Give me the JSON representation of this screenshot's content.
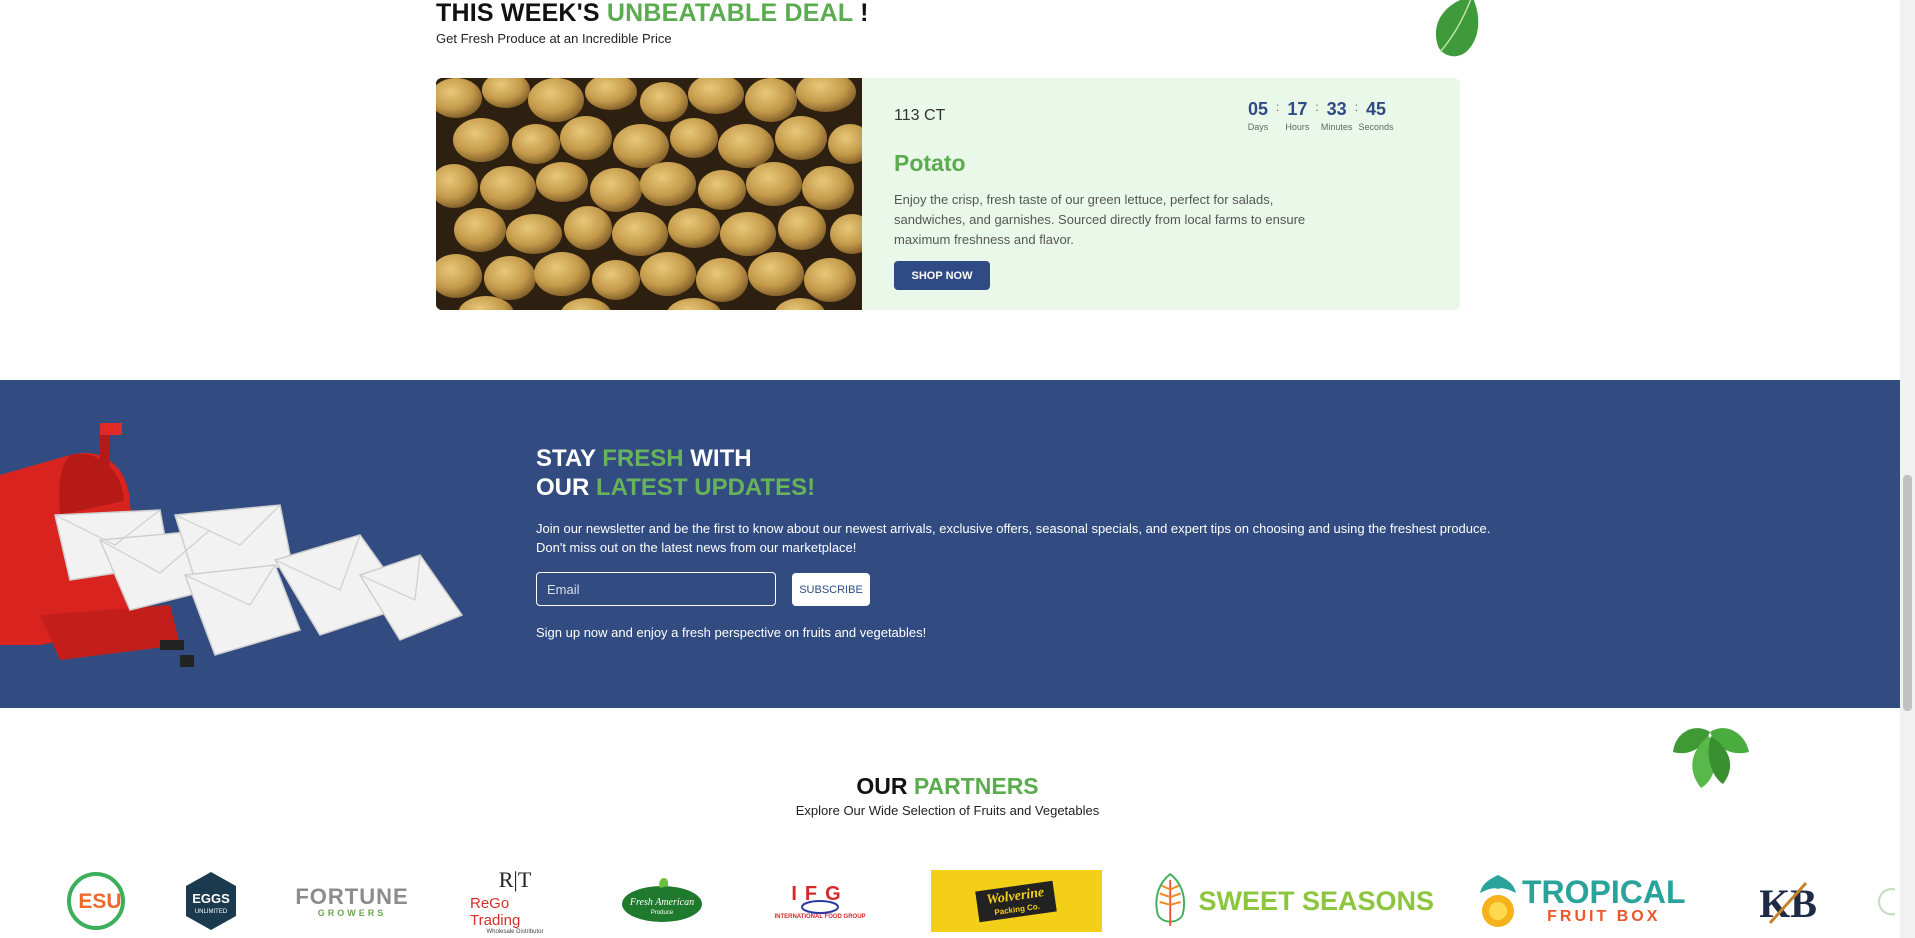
{
  "deal": {
    "title_prefix": "THIS WEEK'S",
    "title_highlight": "UNBEATABLE DEAL",
    "title_suffix": "!",
    "subtitle": "Get Fresh Produce at an Incredible Price",
    "count": "113 CT",
    "product": "Potato",
    "description": "Enjoy the crisp, fresh taste of our green lettuce, perfect for salads, sandwiches, and garnishes. Sourced directly from local farms to ensure maximum freshness and flavor.",
    "cta": "SHOP NOW",
    "countdown": [
      {
        "value": "05",
        "label": "Days"
      },
      {
        "value": "17",
        "label": "Hours"
      },
      {
        "value": "33",
        "label": "Minutes"
      },
      {
        "value": "45",
        "label": "Seconds"
      }
    ],
    "separator": ":"
  },
  "newsletter": {
    "line1_a": "STAY",
    "line1_b": "FRESH",
    "line1_c": "WITH",
    "line2_a": "OUR",
    "line2_b": "LATEST UPDATES!",
    "body": "Join our newsletter and be the first to know about our newest arrivals, exclusive offers, seasonal specials, and expert tips on choosing and using the freshest produce. Don't miss out on the latest news from our marketplace!",
    "email_placeholder": "Email",
    "subscribe": "SUBSCRIBE",
    "footer": "Sign up now and enjoy a fresh perspective on fruits and vegetables!"
  },
  "partners": {
    "title_a": "OUR",
    "title_b": "PARTNERS",
    "subtitle": "Explore Our Wide Selection of Fruits and Vegetables",
    "logos": {
      "esu": "ESU",
      "eggs_1": "EGGS",
      "eggs_2": "UNLIMITED",
      "fortune_1": "FORTUNE",
      "fortune_2": "GROWERS",
      "rego_mark": "R|T",
      "rego_name": "ReGo Trading",
      "rego_sub": "Wholesale Distributor",
      "fresh_american_1": "Fresh American",
      "fresh_american_2": "Produce",
      "ifg_mark": "IFG",
      "ifg_name": "INTERNATIONAL FOOD GROUP",
      "wolverine_1": "Wolverine",
      "wolverine_2": "Packing Co.",
      "sweet_seasons": "SWEET SEASONS",
      "tropical_1": "TROPICAL",
      "tropical_2": "FRUIT BOX",
      "kb": "KB"
    }
  },
  "colors": {
    "green": "#5aac4f",
    "navy": "#324c82",
    "deal_bg": "#eaf8ea"
  }
}
